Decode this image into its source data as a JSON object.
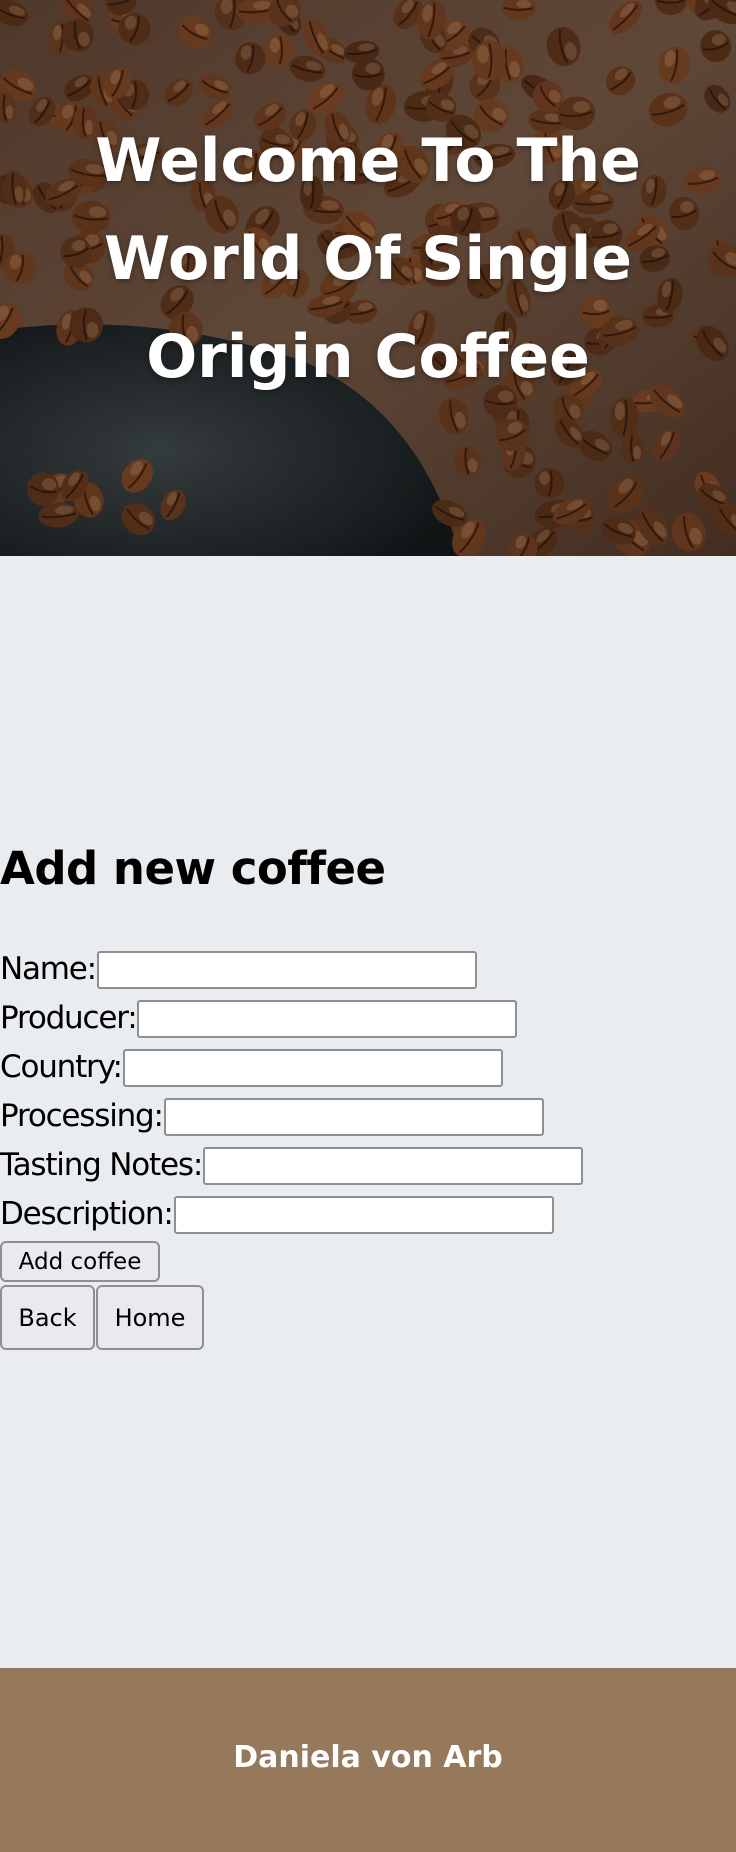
{
  "hero": {
    "title": "Welcome To The World Of Single Origin Coffee",
    "image": "coffee-beans-background"
  },
  "form": {
    "heading": "Add new coffee",
    "fields": [
      {
        "label": "Name:",
        "value": "",
        "placeholder": ""
      },
      {
        "label": "Producer:",
        "value": "",
        "placeholder": ""
      },
      {
        "label": "Country:",
        "value": "",
        "placeholder": ""
      },
      {
        "label": "Processing:",
        "value": "",
        "placeholder": ""
      },
      {
        "label": "Tasting Notes:",
        "value": "",
        "placeholder": ""
      },
      {
        "label": "Description:",
        "value": "",
        "placeholder": ""
      }
    ],
    "submit_label": "Add coffee"
  },
  "nav": {
    "back_label": "Back",
    "home_label": "Home"
  },
  "footer": {
    "author": "Daniela von Arb"
  },
  "colors": {
    "page_background": "#eaedef",
    "footer_background": "#96785b",
    "hero_text": "#ffffff",
    "button_background": "#ebe9ee",
    "input_border": "#8e8e95"
  }
}
